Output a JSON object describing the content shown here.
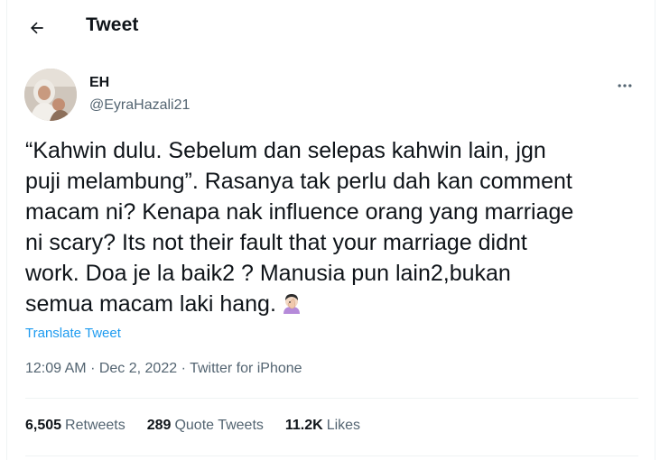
{
  "header": {
    "title": "Tweet",
    "back_icon": "arrow-left-icon"
  },
  "author": {
    "name": "EH",
    "handle": "@EyraHazali21",
    "more_icon": "more-horizontal-icon"
  },
  "tweet": {
    "lines": [
      "“Kahwin dulu. Sebelum dan selepas kahwin lain, jgn",
      "puji melambung”. Rasanya tak perlu dah kan comment",
      "macam ni? Kenapa nak influence orang yang marriage",
      "ni scary? Its not their fault that your marriage didnt",
      "work. Doa je la baik2 ? Manusia pun lain2,bukan",
      "semua macam laki hang."
    ],
    "emoji": "face-palm-woman-emoji",
    "translate_label": "Translate Tweet"
  },
  "meta": {
    "time": "12:09 AM",
    "date": "Dec 2, 2022",
    "source": "Twitter for iPhone",
    "separator": "·"
  },
  "stats": {
    "retweets": {
      "count": "6,505",
      "label": "Retweets"
    },
    "quote_tweets": {
      "count": "289",
      "label": "Quote Tweets"
    },
    "likes": {
      "count": "11.2K",
      "label": "Likes"
    }
  },
  "colors": {
    "text": "#0f1419",
    "secondary": "#536471",
    "link": "#1d9bf0",
    "divider": "#eff3f4"
  }
}
